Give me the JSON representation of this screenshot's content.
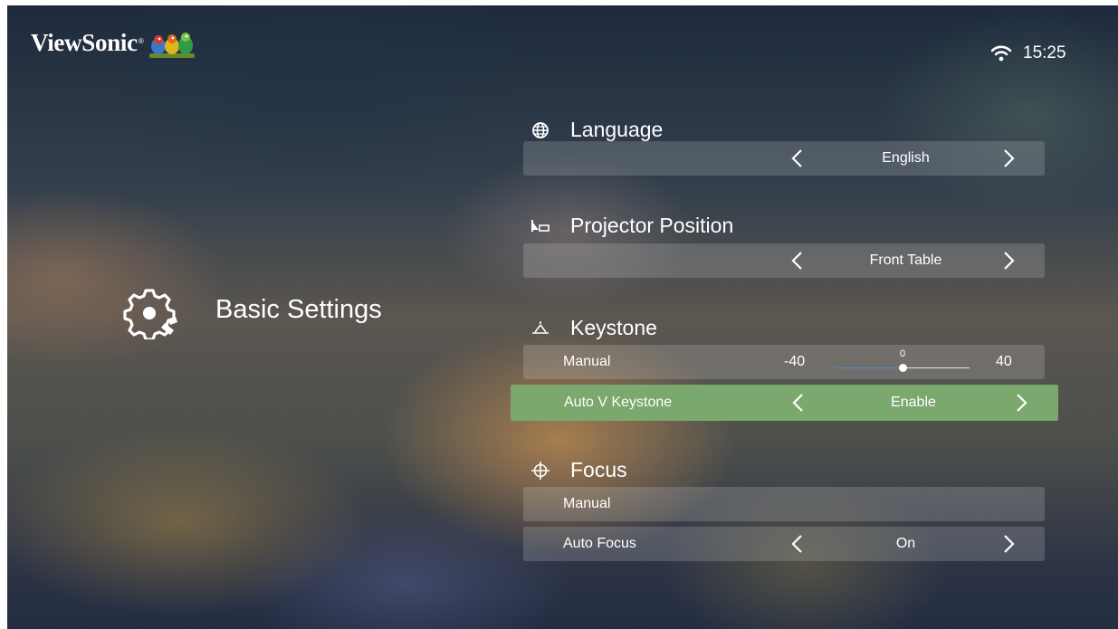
{
  "brand": {
    "name": "ViewSonic",
    "mark": "®"
  },
  "status": {
    "wifi_icon": "wifi-icon",
    "time": "15:25"
  },
  "page": {
    "title": "Basic Settings",
    "icon": "gear-icon"
  },
  "colors": {
    "selected_row": "#7aa86d",
    "slider_fill": "#4a8bd0"
  },
  "sections": {
    "language": {
      "title": "Language",
      "icon": "globe-icon",
      "value": "English"
    },
    "projector_position": {
      "title": "Projector Position",
      "icon": "projector-position-icon",
      "value": "Front Table"
    },
    "keystone": {
      "title": "Keystone",
      "icon": "keystone-icon",
      "manual": {
        "label": "Manual",
        "min": "-40",
        "max": "40",
        "current": "0",
        "min_value": -40,
        "max_value": 40,
        "value": 0
      },
      "auto_v": {
        "label": "Auto V Keystone",
        "value": "Enable",
        "selected": true
      }
    },
    "focus": {
      "title": "Focus",
      "icon": "focus-crosshair-icon",
      "manual": {
        "label": "Manual"
      },
      "auto": {
        "label": "Auto Focus",
        "value": "On"
      }
    }
  }
}
